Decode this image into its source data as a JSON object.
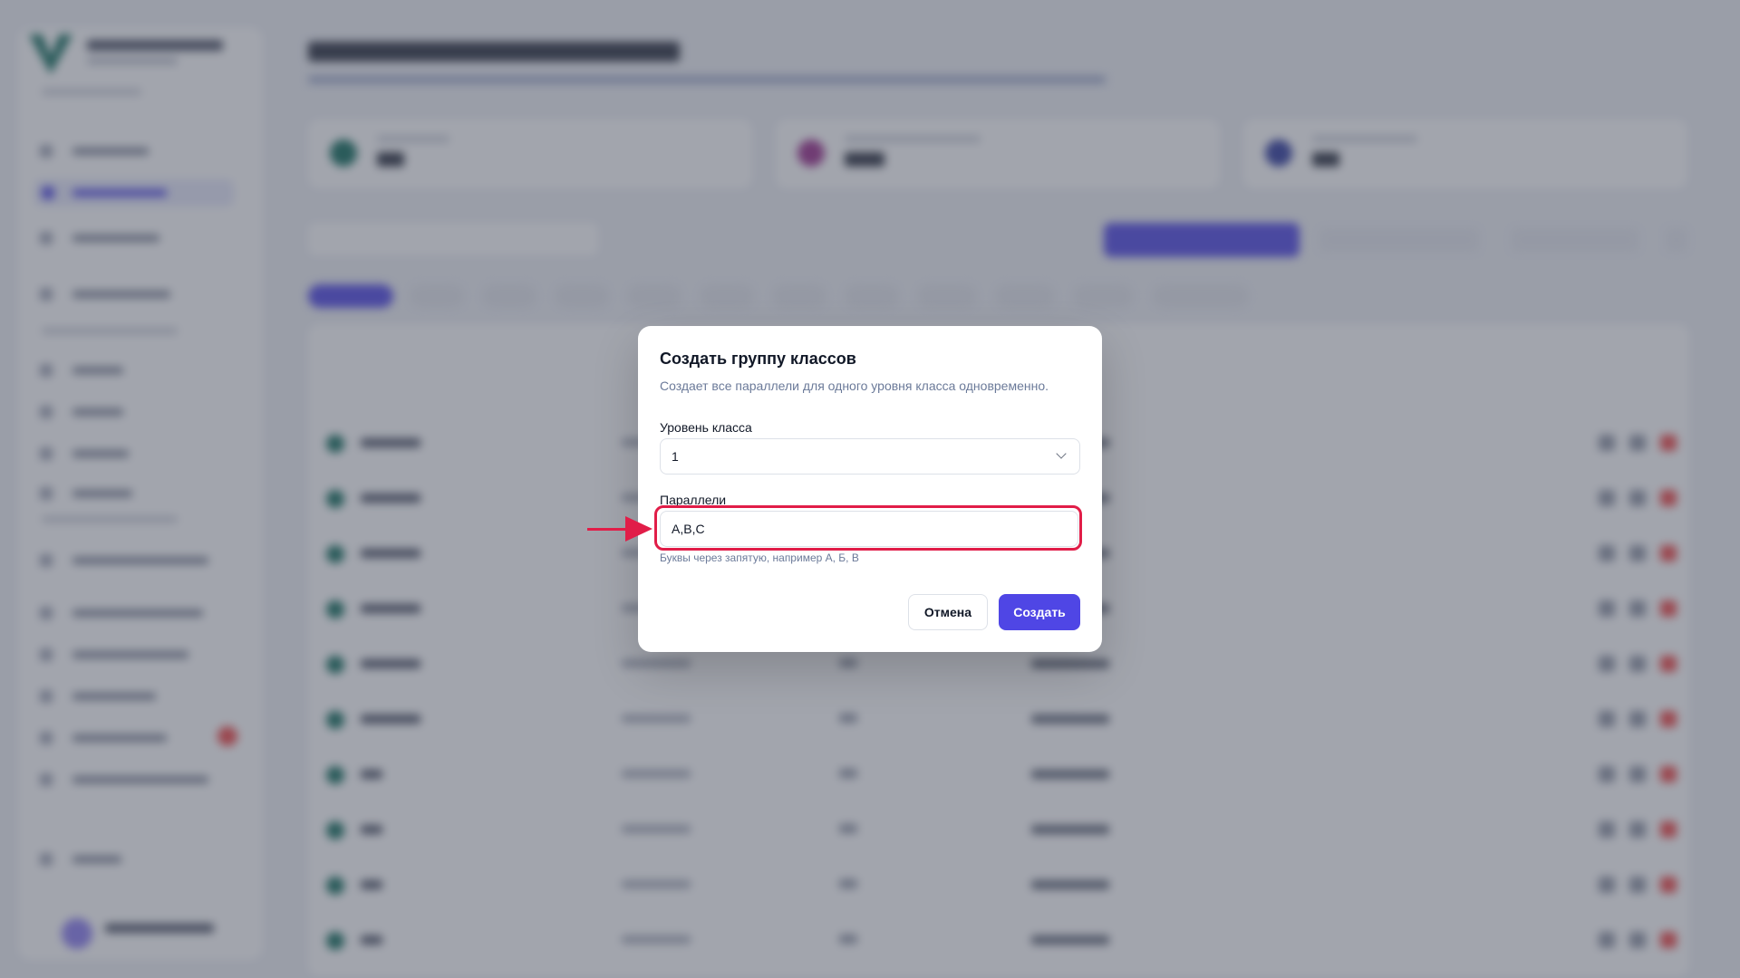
{
  "dialog": {
    "title": "Создать группу классов",
    "description": "Создает все параллели для одного уровня класса одновременно.",
    "grade_label": "Уровень класса",
    "grade_value": "1",
    "parallels_label": "Параллели",
    "parallels_value": "A,B,C",
    "parallels_hint": "Буквы через запятую, например А, Б, В",
    "cancel_label": "Отмена",
    "create_label": "Создать"
  },
  "colors": {
    "accent": "#4f46e5",
    "highlight": "#e11d48",
    "overlay": "#464c5c"
  },
  "icons": {
    "select_chevron": "chevron-down-icon",
    "pointer": "arrow-right-icon"
  }
}
